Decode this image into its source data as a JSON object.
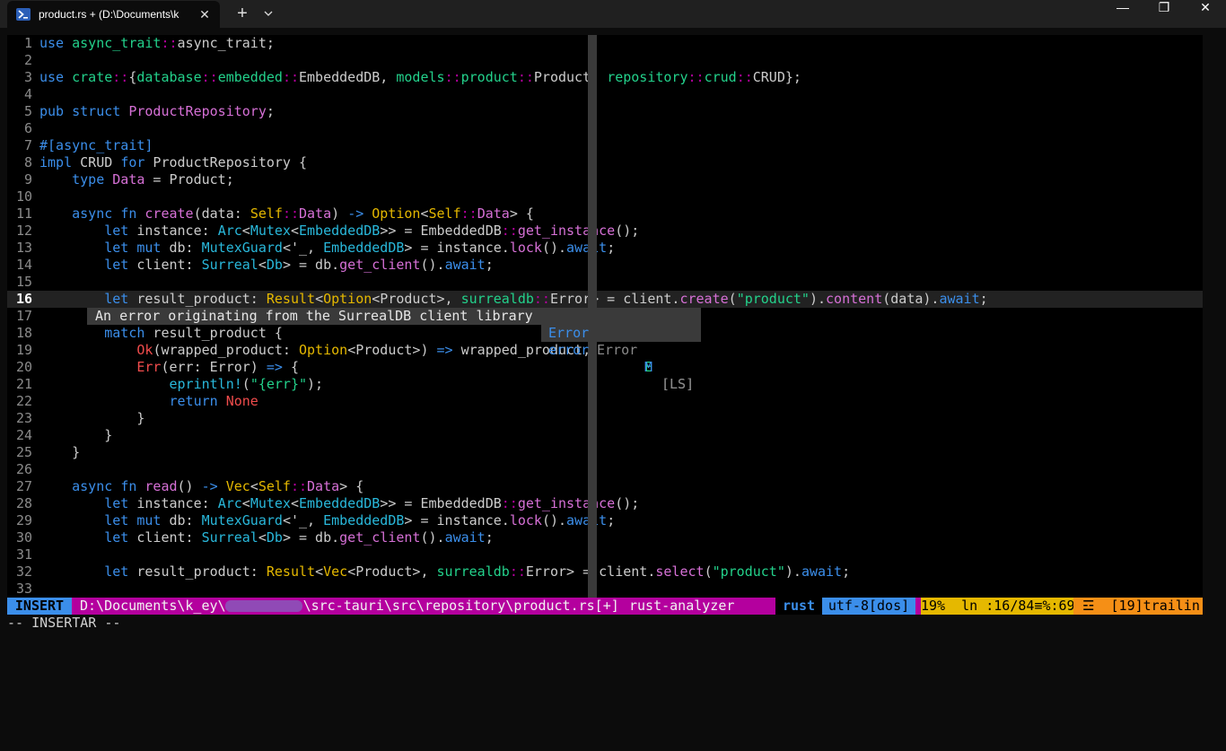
{
  "window": {
    "tab_title": "product.rs + (D:\\Documents\\k",
    "tab_close": "✕",
    "new_tab": "+",
    "dropdown": "⌄",
    "minimize": "—",
    "maximize": "❐",
    "close": "✕"
  },
  "editor": {
    "language": "rust",
    "current_line": 16,
    "lines": [
      {
        "n": "1",
        "t": "use async_trait::async_trait;"
      },
      {
        "n": "2",
        "t": ""
      },
      {
        "n": "3",
        "t": "use crate::{database::embedded::EmbeddedDB, models::product::Product, repository::crud::CRUD};"
      },
      {
        "n": "4",
        "t": ""
      },
      {
        "n": "5",
        "t": "pub struct ProductRepository;"
      },
      {
        "n": "6",
        "t": ""
      },
      {
        "n": "7",
        "t": "#[async_trait]"
      },
      {
        "n": "8",
        "t": "impl CRUD for ProductRepository {"
      },
      {
        "n": "9",
        "t": "    type Data = Product;"
      },
      {
        "n": "10",
        "t": ""
      },
      {
        "n": "11",
        "t": "    async fn create(data: Self::Data) -> Option<Self::Data> {"
      },
      {
        "n": "12",
        "t": "        let instance: Arc<Mutex<EmbeddedDB>> = EmbeddedDB::get_instance();"
      },
      {
        "n": "13",
        "t": "        let mut db: MutexGuard<'_, EmbeddedDB> = instance.lock().await;"
      },
      {
        "n": "14",
        "t": "        let client: Surreal<Db> = db.get_client().await;"
      },
      {
        "n": "15",
        "t": ""
      },
      {
        "n": "16",
        "t": "        let result_product: Result<Option<Product>, surrealdb::Error> = client.create(\"product\").content(data).await;"
      },
      {
        "n": "17",
        "t": ""
      },
      {
        "n": "18",
        "t": "        match result_product {"
      },
      {
        "n": "19",
        "t": "            Ok(wrapped_product: Option<Product>) => wrapped_product,"
      },
      {
        "n": "20",
        "t": "            Err(err: Error) => {"
      },
      {
        "n": "21",
        "t": "                eprintln!(\"{err}\");"
      },
      {
        "n": "22",
        "t": "                return None"
      },
      {
        "n": "23",
        "t": "            }"
      },
      {
        "n": "24",
        "t": "        }"
      },
      {
        "n": "25",
        "t": "    }"
      },
      {
        "n": "26",
        "t": ""
      },
      {
        "n": "27",
        "t": "    async fn read() -> Vec<Self::Data> {"
      },
      {
        "n": "28",
        "t": "        let instance: Arc<Mutex<EmbeddedDB>> = EmbeddedDB::get_instance();"
      },
      {
        "n": "29",
        "t": "        let mut db: MutexGuard<'_, EmbeddedDB> = instance.lock().await;"
      },
      {
        "n": "30",
        "t": "        let client: Surreal<Db> = db.get_client().await;"
      },
      {
        "n": "31",
        "t": ""
      },
      {
        "n": "32",
        "t": "        let result_product: Result<Vec<Product>, surrealdb::Error> = client.select(\"product\").await;"
      },
      {
        "n": "33",
        "t": ""
      }
    ]
  },
  "hover_hint": "An error originating from the SurrealDB client library",
  "completion": [
    {
      "label": "Error",
      "detail": "Error",
      "kind": "E",
      "source": "[LS]",
      "selected": true
    },
    {
      "label": "error",
      "detail": "",
      "kind": "M",
      "source": "[LS]",
      "selected": false
    }
  ],
  "statusline": {
    "mode": "INSERT",
    "path_prefix": "D:\\Documents\\k_ey\\",
    "path_suffix": "\\src-tauri\\src\\repository\\product.rs[+]",
    "lsp": "rust-analyzer",
    "filetype": "rust",
    "encoding": "utf-8[dos]",
    "position": "19%  ln :16/84≡%:69",
    "warnings": "☲  [19]trailin"
  },
  "cmdline": "-- INSERTAR --",
  "colors": {
    "mode_bg": "#3b8eea",
    "statusline_bg": "#b4009e",
    "position_bg": "#e5b800",
    "warning_bg": "#f58f16"
  }
}
